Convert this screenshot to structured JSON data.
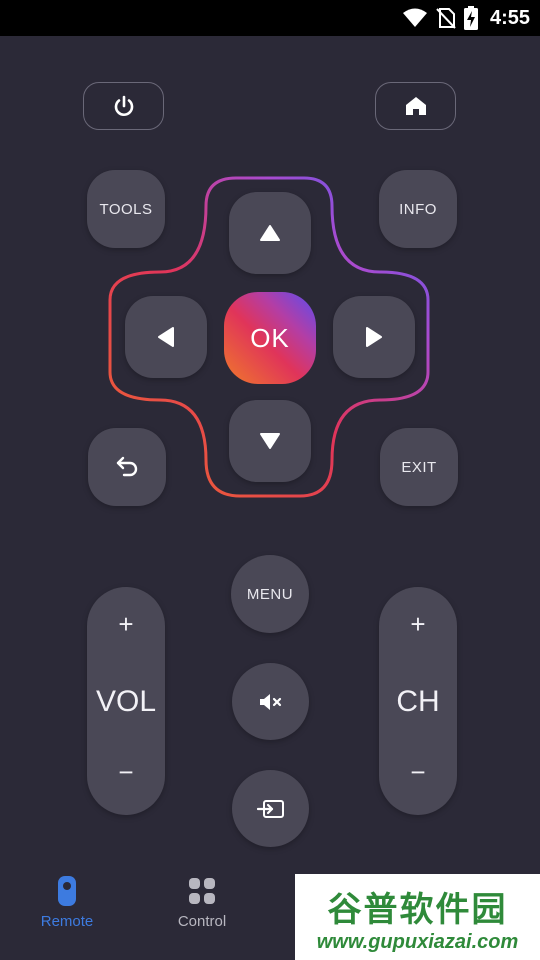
{
  "status_bar": {
    "time": "4:55"
  },
  "remote": {
    "tools_label": "TOOLS",
    "info_label": "INFO",
    "ok_label": "OK",
    "exit_label": "EXIT",
    "menu_label": "MENU",
    "vol": {
      "plus": "+",
      "label": "VOL",
      "minus": "−"
    },
    "ch": {
      "plus": "+",
      "label": "CH",
      "minus": "−"
    }
  },
  "colors": {
    "background": "#2b2937",
    "key": "#4a4856",
    "accent_active": "#3d7be0",
    "nav_inactive": "#b8b7c0"
  },
  "bottom_nav": {
    "items": [
      {
        "label": "Remote",
        "icon": "remote-icon",
        "active": true
      },
      {
        "label": "Control",
        "icon": "grid-icon",
        "active": false
      }
    ]
  },
  "watermark": {
    "text_cn": "谷普软件园",
    "url": "www.gupuxiazai.com"
  }
}
